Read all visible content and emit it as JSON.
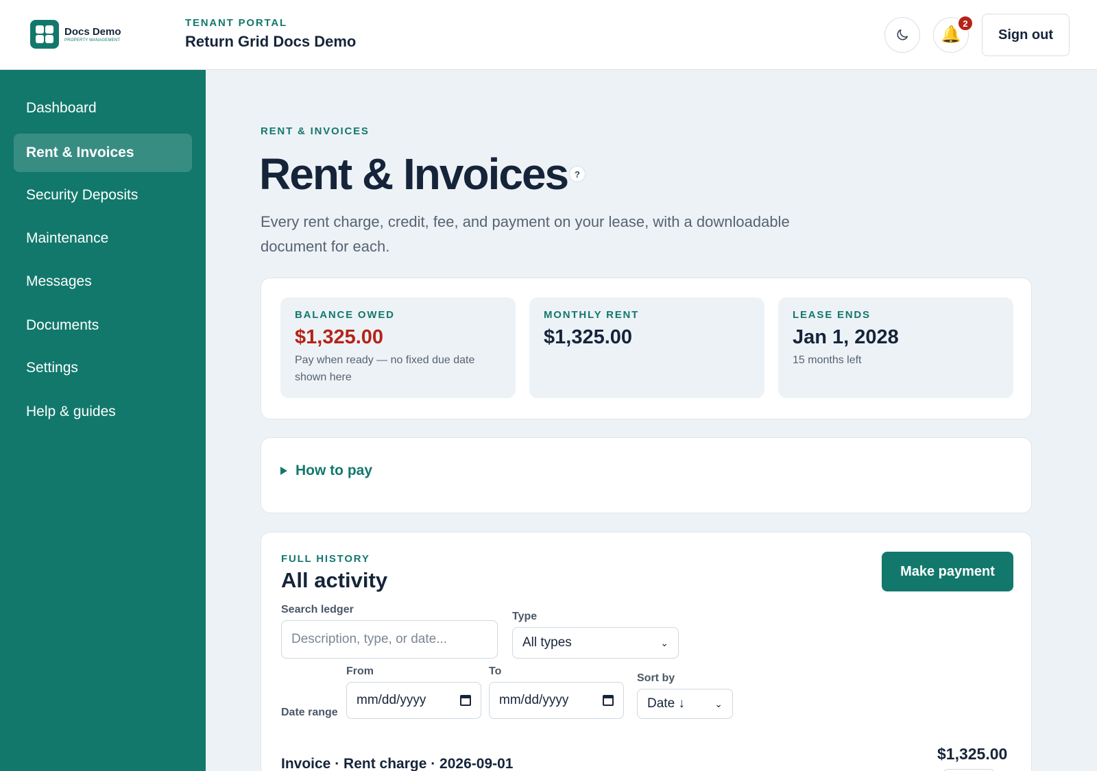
{
  "header": {
    "logo_name": "Docs Demo",
    "logo_sub": "PROPERTY MANAGEMENT",
    "portal_label": "TENANT PORTAL",
    "portal_title": "Return Grid Docs Demo",
    "notification_count": "2",
    "sign_out_label": "Sign out",
    "icons": {
      "theme": "moon-icon",
      "notifications": "bell-icon"
    }
  },
  "sidebar": {
    "items": [
      {
        "label": "Dashboard",
        "active": false
      },
      {
        "label": "Rent & Invoices",
        "active": true
      },
      {
        "label": "Security Deposits",
        "active": false
      },
      {
        "label": "Maintenance",
        "active": false
      },
      {
        "label": "Messages",
        "active": false
      },
      {
        "label": "Documents",
        "active": false
      },
      {
        "label": "Settings",
        "active": false
      },
      {
        "label": "Help & guides",
        "active": false
      }
    ]
  },
  "page": {
    "eyebrow": "RENT & INVOICES",
    "title": "Rent & Invoices",
    "help_label": "?",
    "description": "Every rent charge, credit, fee, and payment on your lease, with a downloadable document for each."
  },
  "summary": {
    "balance": {
      "label": "BALANCE OWED",
      "value": "$1,325.00",
      "note": "Pay when ready — no fixed due date shown here"
    },
    "rent": {
      "label": "MONTHLY RENT",
      "value": "$1,325.00"
    },
    "lease": {
      "label": "LEASE ENDS",
      "value": "Jan 1, 2028",
      "note": "15 months left"
    }
  },
  "how_to_pay": {
    "label": "How to pay"
  },
  "history": {
    "eyebrow": "FULL HISTORY",
    "title": "All activity",
    "pay_button": "Make payment",
    "search": {
      "label": "Search ledger",
      "placeholder": "Description, type, or date..."
    },
    "type": {
      "label": "Type",
      "value": "All types"
    },
    "date_range": {
      "label": "Date range",
      "from_label": "From",
      "to_label": "To",
      "from_value": "mm/dd/yyyy",
      "to_value": "mm/dd/yyyy"
    },
    "sort": {
      "label": "Sort by",
      "value": "Date ↓"
    },
    "rows": [
      {
        "title": "Invoice · Rent charge · 2026-09-01",
        "amount": "$1,325.00"
      }
    ]
  },
  "colors": {
    "brand": "#12786c",
    "danger": "#b42318",
    "text": "#16243a",
    "page_bg": "#edf2f6"
  }
}
